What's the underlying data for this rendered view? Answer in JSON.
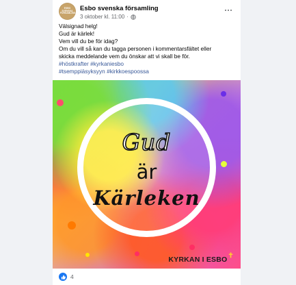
{
  "post": {
    "page_name": "Esbo svenska församling",
    "avatar_text": "ESBO SVENSKA FÖRSAMLING",
    "timestamp": "3 oktober kl. 11:00",
    "separator": "·",
    "body_lines": [
      "Välsignad helg!",
      "Gud är kärlek!",
      "Vem vill du be för idag?",
      "Om du vill så kan du tagga personen i kommentarsfältet eller",
      "skicka meddelande vem du önskar att vi skall be för."
    ],
    "hashtag_lines": [
      [
        "#höstkrafter",
        "#kyrkaniesbo"
      ],
      [
        "#tsemppiäsyksyyn",
        "#kirkkoespoossa"
      ]
    ]
  },
  "image": {
    "line1": "Gud",
    "line2": "är",
    "line3": "Kärleken",
    "brand": "KYRKAN I ESBO",
    "brand_mark": "✝"
  },
  "reactions": {
    "count": "4",
    "icon": "like-icon"
  },
  "colors": {
    "link": "#385898",
    "like": "#1877f2",
    "meta": "#65676b"
  }
}
